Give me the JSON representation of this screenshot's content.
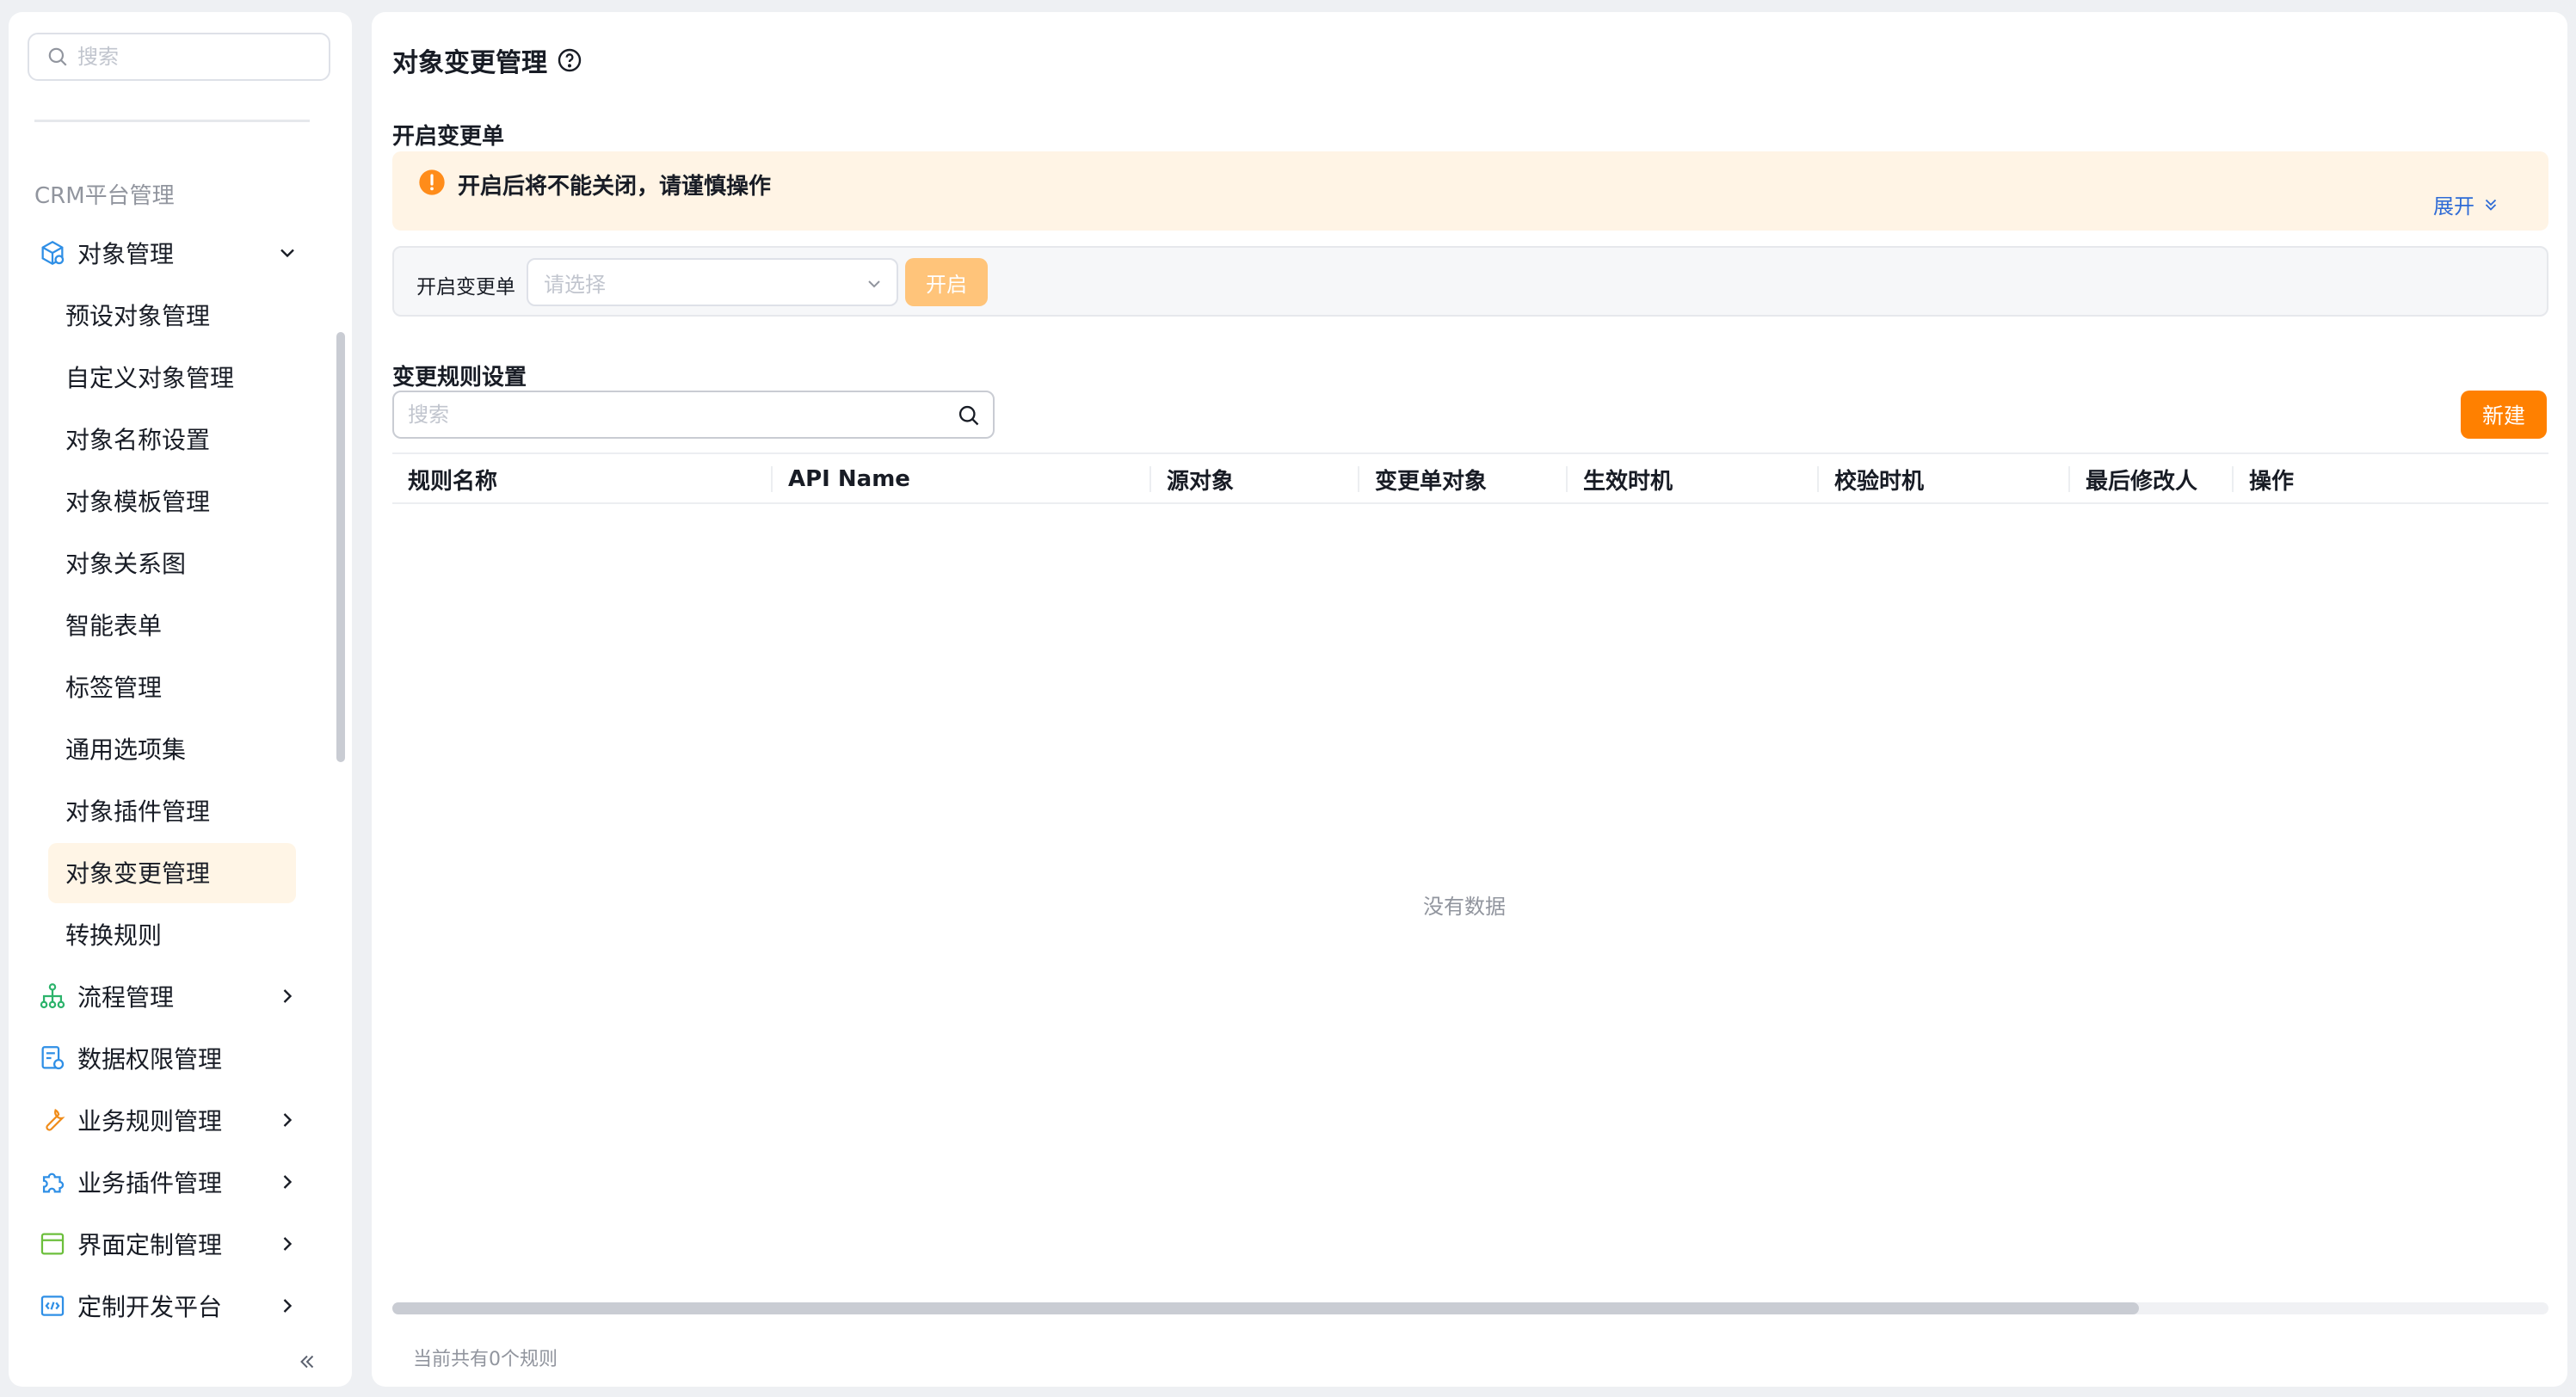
{
  "sidebar": {
    "search_placeholder": "搜索",
    "section_title": "CRM平台管理",
    "object_management": {
      "label": "对象管理",
      "children": [
        "预设对象管理",
        "自定义对象管理",
        "对象名称设置",
        "对象模板管理",
        "对象关系图",
        "智能表单",
        "标签管理",
        "通用选项集",
        "对象插件管理",
        "对象变更管理",
        "转换规则"
      ],
      "active": "对象变更管理"
    },
    "items": [
      {
        "label": "流程管理",
        "icon": "flow-icon",
        "has_children": true
      },
      {
        "label": "数据权限管理",
        "icon": "data-permission-icon",
        "has_children": false
      },
      {
        "label": "业务规则管理",
        "icon": "wrench-icon",
        "has_children": true
      },
      {
        "label": "业务插件管理",
        "icon": "puzzle-icon",
        "has_children": true
      },
      {
        "label": "界面定制管理",
        "icon": "layout-icon",
        "has_children": true
      },
      {
        "label": "定制开发平台",
        "icon": "code-icon",
        "has_children": true
      }
    ],
    "collapse_icon": "double-chevron-left-icon"
  },
  "main": {
    "title": "对象变更管理",
    "open_section": {
      "title": "开启变更单",
      "alert_text": "开启后将不能关闭，请谨慎操作",
      "expand_label": "展开",
      "field_label": "开启变更单",
      "select_placeholder": "请选择",
      "open_button": "开启"
    },
    "rules_section": {
      "title": "变更规则设置",
      "search_placeholder": "搜索",
      "new_button": "新建",
      "columns": [
        "规则名称",
        "API Name",
        "源对象",
        "变更单对象",
        "生效时机",
        "校验时机",
        "最后修改人",
        "操作"
      ],
      "rows": [],
      "empty_text": "没有数据",
      "count_text": "当前共有0个规则",
      "scroll_fraction": 0.81
    }
  },
  "colors": {
    "accent": "#ff8000",
    "accent_disabled": "#ffc47a",
    "alert_bg": "#fff4e5",
    "active_menu_bg": "#fff5e6",
    "link": "#2f6bd6"
  }
}
